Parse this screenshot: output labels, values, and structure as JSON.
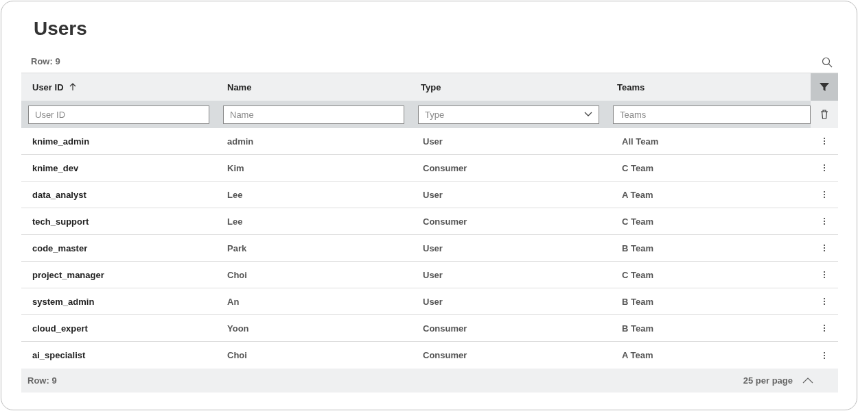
{
  "title": "Users",
  "row_count_top": "Row: 9",
  "filter_active": true,
  "columns": [
    {
      "label": "User ID",
      "sorted": true,
      "placeholder": "User ID",
      "kind": "text"
    },
    {
      "label": "Name",
      "sorted": false,
      "placeholder": "Name",
      "kind": "text"
    },
    {
      "label": "Type",
      "sorted": false,
      "placeholder": "Type",
      "kind": "select"
    },
    {
      "label": "Teams",
      "sorted": false,
      "placeholder": "Teams",
      "kind": "text"
    }
  ],
  "rows": [
    [
      "knime_admin",
      "admin",
      "User",
      "All Team"
    ],
    [
      "knime_dev",
      "Kim",
      "Consumer",
      "C Team"
    ],
    [
      "data_analyst",
      "Lee",
      "User",
      "A Team"
    ],
    [
      "tech_support",
      "Lee",
      "Consumer",
      "C Team"
    ],
    [
      "code_master",
      "Park",
      "User",
      "B Team"
    ],
    [
      "project_manager",
      "Choi",
      "User",
      "C Team"
    ],
    [
      "system_admin",
      "An",
      "User",
      "B Team"
    ],
    [
      "cloud_expert",
      "Yoon",
      "Consumer",
      "B Team"
    ],
    [
      "ai_specialist",
      "Choi",
      "Consumer",
      "A Team"
    ]
  ],
  "footer": {
    "row_count": "Row: 9",
    "per_page": "25 per page"
  }
}
